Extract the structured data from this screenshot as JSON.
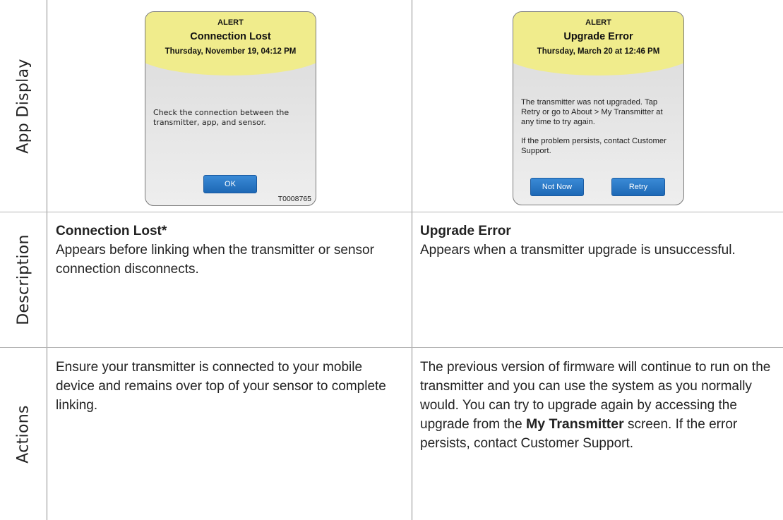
{
  "row_labels": {
    "app_display": "App Display",
    "description": "Description",
    "actions": "Actions"
  },
  "left": {
    "card": {
      "alert": "ALERT",
      "title": "Connection Lost",
      "date": "Thursday, November 19, 04:12 PM",
      "body": "Check the connection between the transmitter, app, and sensor.",
      "ok_button": "OK",
      "code": "T0008765"
    },
    "description": {
      "heading": "Connection Lost*",
      "text": "Appears before linking when the transmitter or sensor connection disconnects."
    },
    "actions": {
      "text": "Ensure your transmitter is connected to your mobile device and remains over top of your sensor to complete linking."
    }
  },
  "right": {
    "card": {
      "alert": "ALERT",
      "title": "Upgrade Error",
      "date": "Thursday, March 20 at 12:46 PM",
      "body1": "The transmitter was not upgraded. Tap Retry or go to About > My Transmitter at any time to try again.",
      "body2": "If the problem persists, contact Customer Support.",
      "not_now_button": "Not Now",
      "retry_button": "Retry"
    },
    "description": {
      "heading": "Upgrade Error",
      "text": "Appears when a transmitter upgrade is unsuccessful."
    },
    "actions": {
      "text_before": "The previous version of firmware will continue to run on the transmitter and you can use the system as you normally would. You can try to upgrade again by accessing the upgrade from the",
      "strong": "My Transmitter",
      "text_after": "screen. If the error persists, contact Customer Support."
    }
  },
  "colors": {
    "alert_header": "#f0ec8c",
    "button_blue": "#1d68b5",
    "grid_line": "#8a8a8a"
  }
}
